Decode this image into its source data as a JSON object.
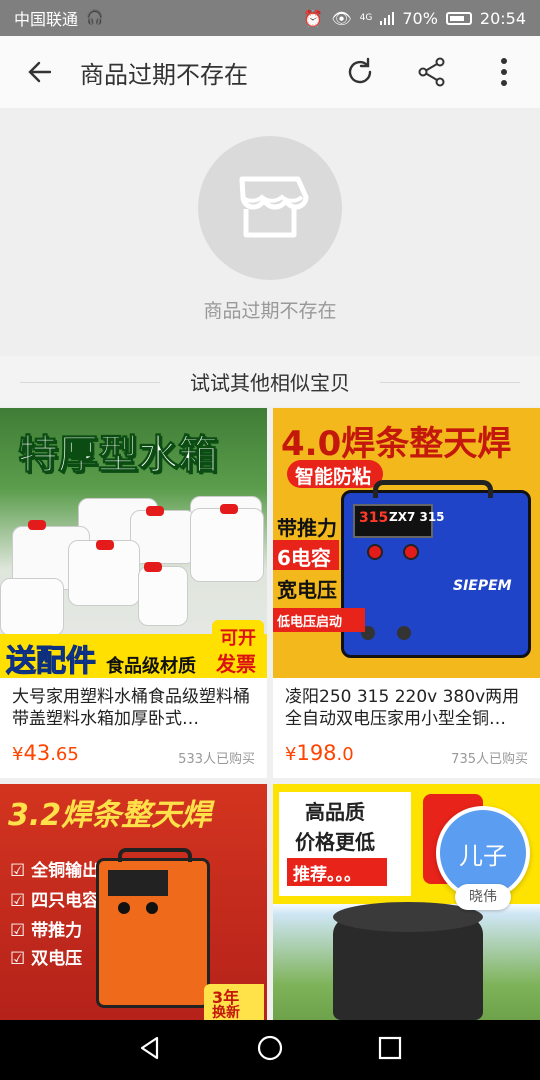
{
  "status": {
    "carrier": "中国联通",
    "battery": "70%",
    "time": "20:54",
    "signal": "4G"
  },
  "header": {
    "title": "商品过期不存在",
    "icons": [
      "back-arrow-icon",
      "refresh-icon",
      "share-icon",
      "more-vertical-icon"
    ]
  },
  "empty_state": {
    "message": "商品过期不存在",
    "icon": "store-icon"
  },
  "section": {
    "title": "试试其他相似宝贝"
  },
  "products": [
    {
      "image_text": [
        "特厚型水箱",
        "送配件",
        "食品级材质",
        "可开",
        "发票"
      ],
      "name": "大号家用塑料水桶食品级塑料桶带盖塑料水箱加厚卧式…",
      "price_symbol": "¥",
      "price_int": "43",
      "price_dec": ".65",
      "sold": "533人已购买"
    },
    {
      "image_text": [
        "4.0焊条整天焊",
        "智能防粘",
        "带推力",
        "6电容",
        "宽电压",
        "低电压启动",
        "SIEPEM",
        "ZX7 315"
      ],
      "name": "凌阳250 315 220v 380v两用全自动双电压家用小型全铜…",
      "price_symbol": "¥",
      "price_int": "198",
      "price_dec": ".0",
      "sold": "735人已购买"
    },
    {
      "image_text": [
        "3.2焊条整天焊",
        "全铜输出",
        "四只电容",
        "带推力",
        "双电压",
        "3年",
        "换新"
      ]
    },
    {
      "image_text": [
        "高品质",
        "价格更低",
        "推荐。。。"
      ]
    }
  ],
  "floating": {
    "avatar_text": "儿子",
    "name": "晓伟"
  },
  "colors": {
    "price": "#ff4400",
    "statusbar": "#7f7f7f",
    "avatar": "#5b9df0"
  }
}
